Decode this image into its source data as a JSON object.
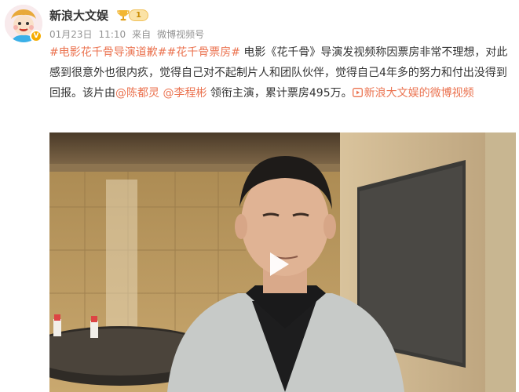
{
  "post": {
    "author": "新浪大文娱",
    "level": "1",
    "date": "01月23日",
    "time": "11:10",
    "source_prefix": "来自",
    "source": "微博视频号",
    "topic1": "#电影花千骨导演道歉#",
    "topic2": "#花千骨票房#",
    "text1": " 电影《花千骨》导演发视频称因票房非常不理想，对此感到很意外也很内疚，觉得自己对不起制片人和团队伙伴，觉得自己4年多的努力和付出没得到回报。该片由",
    "mention1": "@陈都灵",
    "text2": " ",
    "mention2": "@李程彬",
    "text3": " 领衔主演，累计票房495万。",
    "video_link": "新浪大文娱的微博视频"
  },
  "colors": {
    "link": "#eb7350",
    "meta": "#939393",
    "verify": "#f6ad00"
  }
}
